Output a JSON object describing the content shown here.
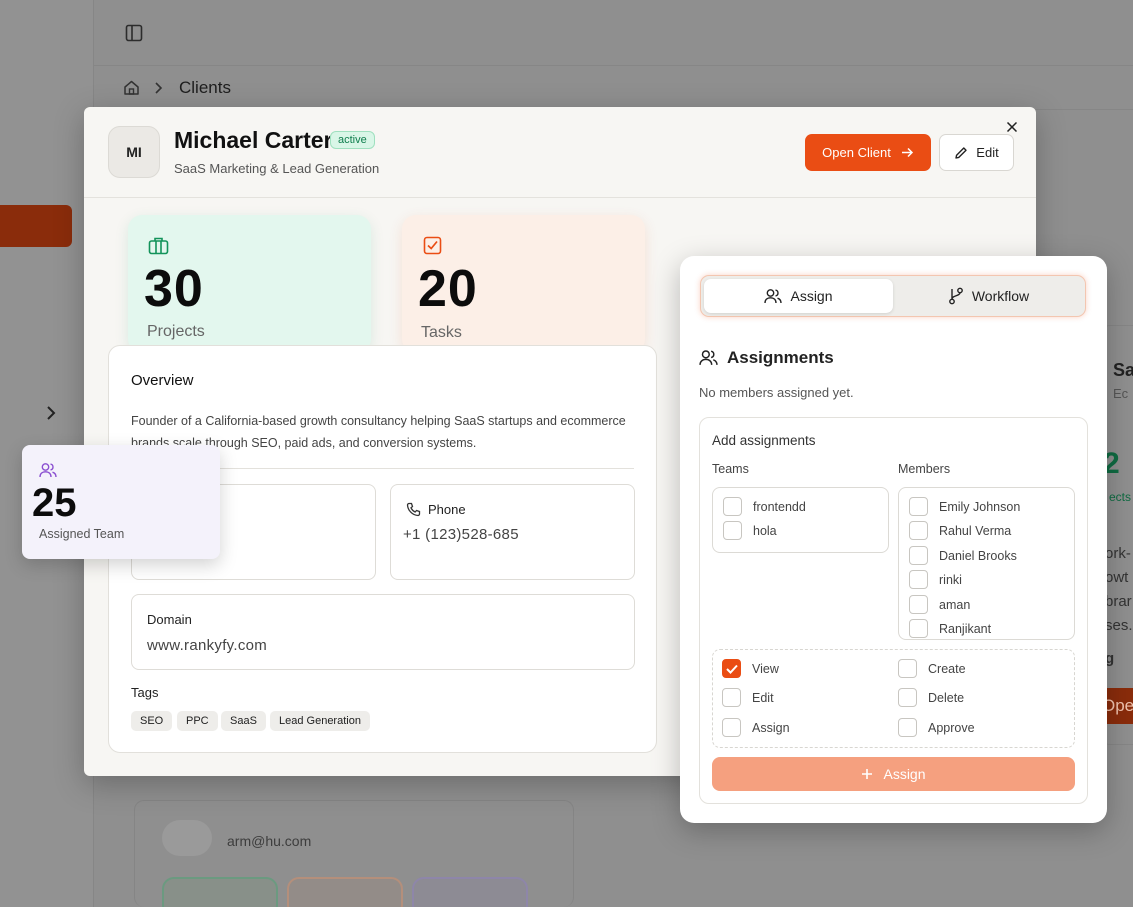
{
  "background": {
    "breadcrumb": "Clients",
    "email": "arm@hu.com",
    "right_card_letters": "Sa",
    "right_card_sub": "Ec",
    "right_card_num": "2",
    "right_card_text": [
      "ork-",
      "owt",
      "brar",
      "ses."
    ],
    "right_card_btn": "Ope"
  },
  "client": {
    "initials": "MI",
    "name": "Michael Carter",
    "status": "active",
    "subtitle": "SaaS Marketing & Lead Generation",
    "open_label": "Open Client",
    "edit_label": "Edit"
  },
  "stats": {
    "projects": {
      "value": "30",
      "label": "Projects"
    },
    "tasks": {
      "value": "20",
      "label": "Tasks"
    },
    "team": {
      "value": "25",
      "label": "Assigned Team"
    }
  },
  "overview": {
    "title": "Overview",
    "description": "Founder of a California-based growth consultancy helping SaaS startups and ecommerce brands scale through SEO, paid ads, and conversion systems.",
    "phone_label": "Phone",
    "phone_value": "+1 (123)528-685",
    "domain_label": "Domain",
    "domain_value": "www.rankyfy.com",
    "tags_label": "Tags",
    "tags": [
      "SEO",
      "PPC",
      "SaaS",
      "Lead Generation"
    ]
  },
  "panel": {
    "tabs": [
      "Assign",
      "Workflow"
    ],
    "title": "Assignments",
    "empty": "No members assigned yet.",
    "add_title": "Add assignments",
    "teams_title": "Teams",
    "members_title": "Members",
    "teams": [
      "frontendd",
      "hola"
    ],
    "members": [
      "Emily Johnson",
      "Rahul Verma",
      "Daniel Brooks",
      "rinki",
      "aman",
      "Ranjikant"
    ],
    "permissions": [
      {
        "label": "View",
        "checked": true
      },
      {
        "label": "Create",
        "checked": false
      },
      {
        "label": "Edit",
        "checked": false
      },
      {
        "label": "Delete",
        "checked": false
      },
      {
        "label": "Assign",
        "checked": false
      },
      {
        "label": "Approve",
        "checked": false
      }
    ],
    "assign_button": "Assign"
  },
  "colors": {
    "accent": "#ea4d14",
    "success": "#0f7d4d"
  }
}
